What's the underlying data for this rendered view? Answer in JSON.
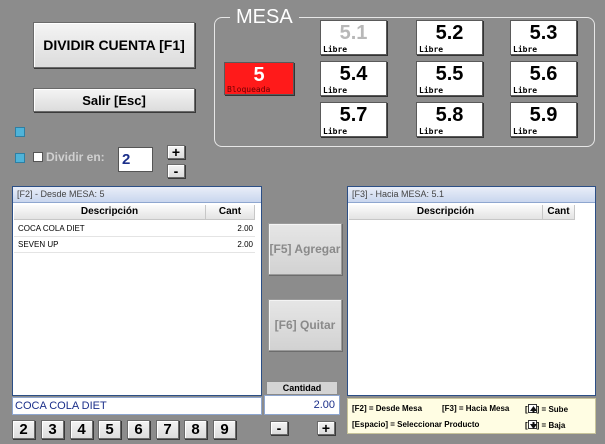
{
  "buttons": {
    "dividir_cuenta": "DIVIDIR CUENTA   [F1]",
    "salir": "Salir    [Esc]",
    "agregar": "[F5] Agregar",
    "quitar": "[F6] Quitar"
  },
  "mesa_group": {
    "legend": "MESA",
    "current": {
      "number": "5",
      "status": "Bloqueada"
    },
    "tables": [
      {
        "number": "5.1",
        "status": "Libre"
      },
      {
        "number": "5.2",
        "status": "Libre"
      },
      {
        "number": "5.3",
        "status": "Libre"
      },
      {
        "number": "5.4",
        "status": "Libre"
      },
      {
        "number": "5.5",
        "status": "Libre"
      },
      {
        "number": "5.6",
        "status": "Libre"
      },
      {
        "number": "5.7",
        "status": "Libre"
      },
      {
        "number": "5.8",
        "status": "Libre"
      },
      {
        "number": "5.9",
        "status": "Libre"
      }
    ]
  },
  "divide": {
    "label": "Dividir en:",
    "value": "2",
    "plus": "+",
    "minus": "-"
  },
  "left_panel": {
    "title": "[F2] - Desde MESA: 5",
    "columns": [
      "Descripción",
      "Cant"
    ],
    "rows": [
      {
        "desc": "COCA COLA DIET",
        "qty": "2.00"
      },
      {
        "desc": "SEVEN UP",
        "qty": "2.00"
      }
    ],
    "selected_product": "COCA COLA DIET"
  },
  "right_panel": {
    "title": "[F3] - Hacia MESA: 5.1",
    "columns": [
      "Descripción",
      "Cant"
    ]
  },
  "cantidad": {
    "label": "Cantidad",
    "value": "2.00",
    "minus": "-",
    "plus": "+"
  },
  "number_keys": [
    "2",
    "3",
    "4",
    "5",
    "6",
    "7",
    "8",
    "9"
  ],
  "legend": {
    "desde": "[F2] = Desde Mesa",
    "hacia": "[F3] = Hacia Mesa",
    "sube": "] = Sube",
    "espacio": "[Espacio] = Seleccionar Producto",
    "baja": "] = Baja",
    "bracket_open": "["
  }
}
